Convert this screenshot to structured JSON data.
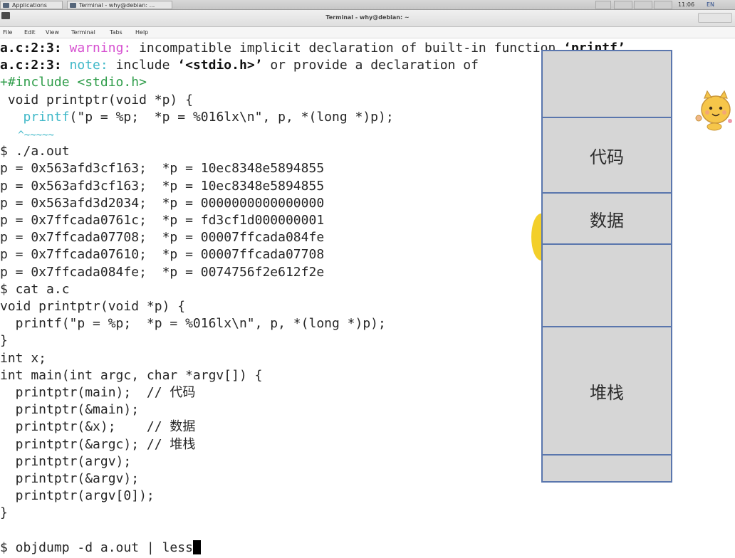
{
  "taskbar": {
    "apps_label": "Applications",
    "task_label": "Terminal - why@debian: ...",
    "clock": "11:06",
    "lang": "EN"
  },
  "window": {
    "title": "Terminal - why@debian: ~"
  },
  "menu": [
    "File",
    "Edit",
    "View",
    "Terminal",
    "Tabs",
    "Help"
  ],
  "terminal": {
    "lines": [
      [
        {
          "t": "a.c:2:3: ",
          "c": "bold"
        },
        {
          "t": "warning:",
          "c": "warn"
        },
        {
          "t": " incompatible implicit declaration of built-in function ",
          "c": ""
        },
        {
          "t": "‘printf’",
          "c": "bold"
        }
      ],
      [
        {
          "t": "a.c:2:3: ",
          "c": "bold"
        },
        {
          "t": "note:",
          "c": "note"
        },
        {
          "t": " include ",
          "c": ""
        },
        {
          "t": "‘<stdio.h>’",
          "c": "bold"
        },
        {
          "t": " or provide a declaration of",
          "c": ""
        }
      ],
      [
        {
          "t": "+#include <stdio.h>",
          "c": "green"
        }
      ],
      [
        {
          "t": " void printptr(void *p) {",
          "c": ""
        }
      ],
      [
        {
          "t": "   ",
          "c": ""
        },
        {
          "t": "printf",
          "c": "note"
        },
        {
          "t": "(\"p = %p;  *p = %016lx\\n\", p, *(long *)p);",
          "c": ""
        }
      ],
      [
        {
          "t": "   ^~~~~~",
          "c": "under"
        }
      ],
      [
        {
          "t": "$ ./a.out",
          "c": ""
        }
      ],
      [
        {
          "t": "p = 0x563afd3cf163;  *p = 10ec8348e5894855",
          "c": ""
        }
      ],
      [
        {
          "t": "p = 0x563afd3cf163;  *p = 10ec8348e5894855",
          "c": ""
        }
      ],
      [
        {
          "t": "p = 0x563afd3d2034;  *p = 0000000000000000",
          "c": ""
        }
      ],
      [
        {
          "t": "p = 0x7ffcada0761c;  *p = fd3cf1d000000001",
          "c": ""
        }
      ],
      [
        {
          "t": "p = 0x7ffcada07708;  *p = 00007ffcada084fe",
          "c": ""
        }
      ],
      [
        {
          "t": "p = 0x7ffcada07610;  *p = 00007ffcada07708",
          "c": ""
        }
      ],
      [
        {
          "t": "p = 0x7ffcada084fe;  *p = 0074756f2e612f2e",
          "c": ""
        }
      ],
      [
        {
          "t": "$ cat a.c",
          "c": ""
        }
      ],
      [
        {
          "t": "void printptr(void *p) {",
          "c": ""
        }
      ],
      [
        {
          "t": "  printf(\"p = %p;  *p = %016lx\\n\", p, *(long *)p);",
          "c": ""
        }
      ],
      [
        {
          "t": "}",
          "c": ""
        }
      ],
      [
        {
          "t": "int x;",
          "c": ""
        }
      ],
      [
        {
          "t": "int main(int argc, char *argv[]) {",
          "c": ""
        }
      ],
      [
        {
          "t": "  printptr(main);  // 代码",
          "c": ""
        }
      ],
      [
        {
          "t": "  printptr(&main);",
          "c": ""
        }
      ],
      [
        {
          "t": "  printptr(&x);    // 数据",
          "c": ""
        }
      ],
      [
        {
          "t": "  printptr(&argc); // 堆栈",
          "c": ""
        }
      ],
      [
        {
          "t": "  printptr(argv);",
          "c": ""
        }
      ],
      [
        {
          "t": "  printptr(&argv);",
          "c": ""
        }
      ],
      [
        {
          "t": "  printptr(argv[0]);",
          "c": ""
        }
      ],
      [
        {
          "t": "}",
          "c": ""
        }
      ],
      [
        {
          "t": "",
          "c": ""
        }
      ]
    ],
    "prompt": "$ objdump -d a.out | less"
  },
  "memory_diagram": {
    "segments": [
      "",
      "代码",
      "数据",
      "",
      "堆栈",
      ""
    ]
  },
  "colors": {
    "warning": "#d64fd0",
    "note": "#3fb8c8",
    "diff_add": "#2f9d4a",
    "diagram_border": "#5a76ad",
    "diagram_fill": "#d6d6d6"
  }
}
